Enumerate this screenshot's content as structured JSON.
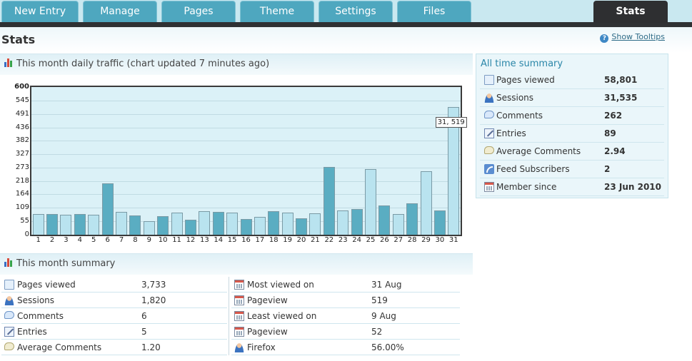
{
  "nav": {
    "tabs": [
      {
        "label": "New Entry"
      },
      {
        "label": "Manage"
      },
      {
        "label": "Pages"
      },
      {
        "label": "Theme"
      },
      {
        "label": "Settings"
      },
      {
        "label": "Files"
      },
      {
        "label": "Stats",
        "active": true
      }
    ]
  },
  "page": {
    "title": "Stats",
    "tooltips_link": "Show Tooltips"
  },
  "traffic_panel": {
    "title": "This month daily traffic (chart updated 7 minutes ago)"
  },
  "chart_data": {
    "type": "bar",
    "title": "",
    "xlabel": "",
    "ylabel": "",
    "ylim": [
      0,
      600
    ],
    "y_ticks": [
      "600",
      "545",
      "491",
      "436",
      "382",
      "327",
      "273",
      "218",
      "164",
      "109",
      "55",
      "0"
    ],
    "categories": [
      "1",
      "2",
      "3",
      "4",
      "5",
      "6",
      "7",
      "8",
      "9",
      "10",
      "11",
      "12",
      "13",
      "14",
      "15",
      "16",
      "17",
      "18",
      "19",
      "20",
      "21",
      "22",
      "23",
      "24",
      "25",
      "26",
      "27",
      "28",
      "29",
      "30",
      "31"
    ],
    "values": [
      84,
      83,
      80,
      85,
      80,
      209,
      92,
      78,
      56,
      74,
      90,
      61,
      97,
      92,
      91,
      64,
      73,
      96,
      90,
      67,
      87,
      276,
      100,
      104,
      268,
      120,
      85,
      127,
      257,
      98,
      519
    ],
    "grid": true,
    "legend": "none",
    "tooltip_label": "31, 519"
  },
  "alltime": {
    "title": "All time summary",
    "rows": [
      {
        "label": "Pages viewed",
        "value": "58,801",
        "icon": "page-icon"
      },
      {
        "label": "Sessions",
        "value": "31,535",
        "icon": "person-icon"
      },
      {
        "label": "Comments",
        "value": "262",
        "icon": "comment-icon"
      },
      {
        "label": "Entries",
        "value": "89",
        "icon": "entry-icon"
      },
      {
        "label": "Average Comments",
        "value": "2.94",
        "icon": "average-comment-icon"
      },
      {
        "label": "Feed Subscribers",
        "value": "2",
        "icon": "feed-icon"
      },
      {
        "label": "Member since",
        "value": "23 Jun 2010",
        "icon": "calendar-icon"
      }
    ]
  },
  "month_summary": {
    "title": "This month summary",
    "left": [
      {
        "label": "Pages viewed",
        "value": "3,733",
        "icon": "page-icon"
      },
      {
        "label": "Sessions",
        "value": "1,820",
        "icon": "person-icon"
      },
      {
        "label": "Comments",
        "value": "6",
        "icon": "comment-icon"
      },
      {
        "label": "Entries",
        "value": "5",
        "icon": "entry-icon"
      },
      {
        "label": "Average Comments",
        "value": "1.20",
        "icon": "average-comment-icon"
      }
    ],
    "right": [
      {
        "label": "Most viewed on",
        "value": "31 Aug",
        "icon": "calendar-icon"
      },
      {
        "label": "Pageview",
        "value": "519",
        "icon": "calendar-icon"
      },
      {
        "label": "Least viewed on",
        "value": "9 Aug",
        "icon": "calendar-icon"
      },
      {
        "label": "Pageview",
        "value": "52",
        "icon": "calendar-icon"
      },
      {
        "label": "Firefox",
        "value": "56.00%",
        "icon": "person-icon"
      }
    ]
  },
  "colors": {
    "nav_tab": "#4ea7bf",
    "nav_active": "#2e2f31",
    "bar_light": "#b9e3ef",
    "bar_dark": "#5aadc2",
    "chart_bg": "#dbf1f7",
    "accent_title": "#2a86a8"
  }
}
